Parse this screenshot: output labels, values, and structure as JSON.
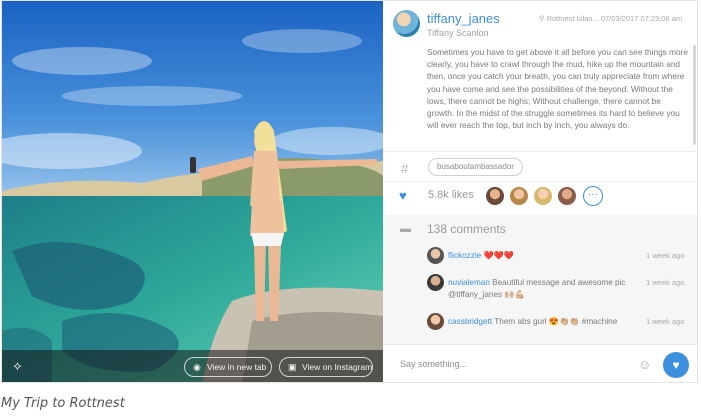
{
  "photo": {
    "actions": {
      "view_new_tab": "View in new tab",
      "view_instagram": "View on Instagram"
    },
    "icons": {
      "wand": "magic-wand-icon",
      "eye": "eye-icon",
      "instagram": "instagram-icon"
    }
  },
  "post": {
    "username": "tiffany_janes",
    "fullname": "Tiffany Scanlon",
    "location": "Rottnest Islan...",
    "timestamp": "07/03/2017 07:23:06 am",
    "caption": "Sometimes you have to get above it all before you can see things more clearly, you have to crawl through the mud, hike up the mountain and then, once you catch your breath, you can truly appreciate from where you have come and see the possibilities of the beyond. Without the lows, there cannot be highs; Without challenge, there cannot be growth. In the midst of the struggle sometimes its hard to believe you will ever reach the top, but inch by inch, you always do."
  },
  "tags": {
    "hash_symbol": "#",
    "items": [
      "busaboutambassador"
    ]
  },
  "likes": {
    "count_label": "5.8k likes"
  },
  "comments": {
    "count_label": "138 comments",
    "items": [
      {
        "user": "flickozzie",
        "text": "❤️❤️❤️",
        "time": "1 week ago"
      },
      {
        "user": "nuvialeman",
        "text": "Beautiful message and awesome pic @tiffany_janes 🙌🏼💪🏼",
        "time": "1 week ago"
      },
      {
        "user": "cassbridgett",
        "text": "Them abs gurl 😍👏🏼👏🏼 #machine",
        "time": "1 week ago"
      }
    ]
  },
  "composer": {
    "placeholder": "Say something..."
  },
  "page_caption": "My Trip to Rottnest",
  "colors": {
    "accent": "#3d8fe0",
    "text_muted": "#7a7a7a",
    "comments_bg": "#f6f6f6"
  }
}
